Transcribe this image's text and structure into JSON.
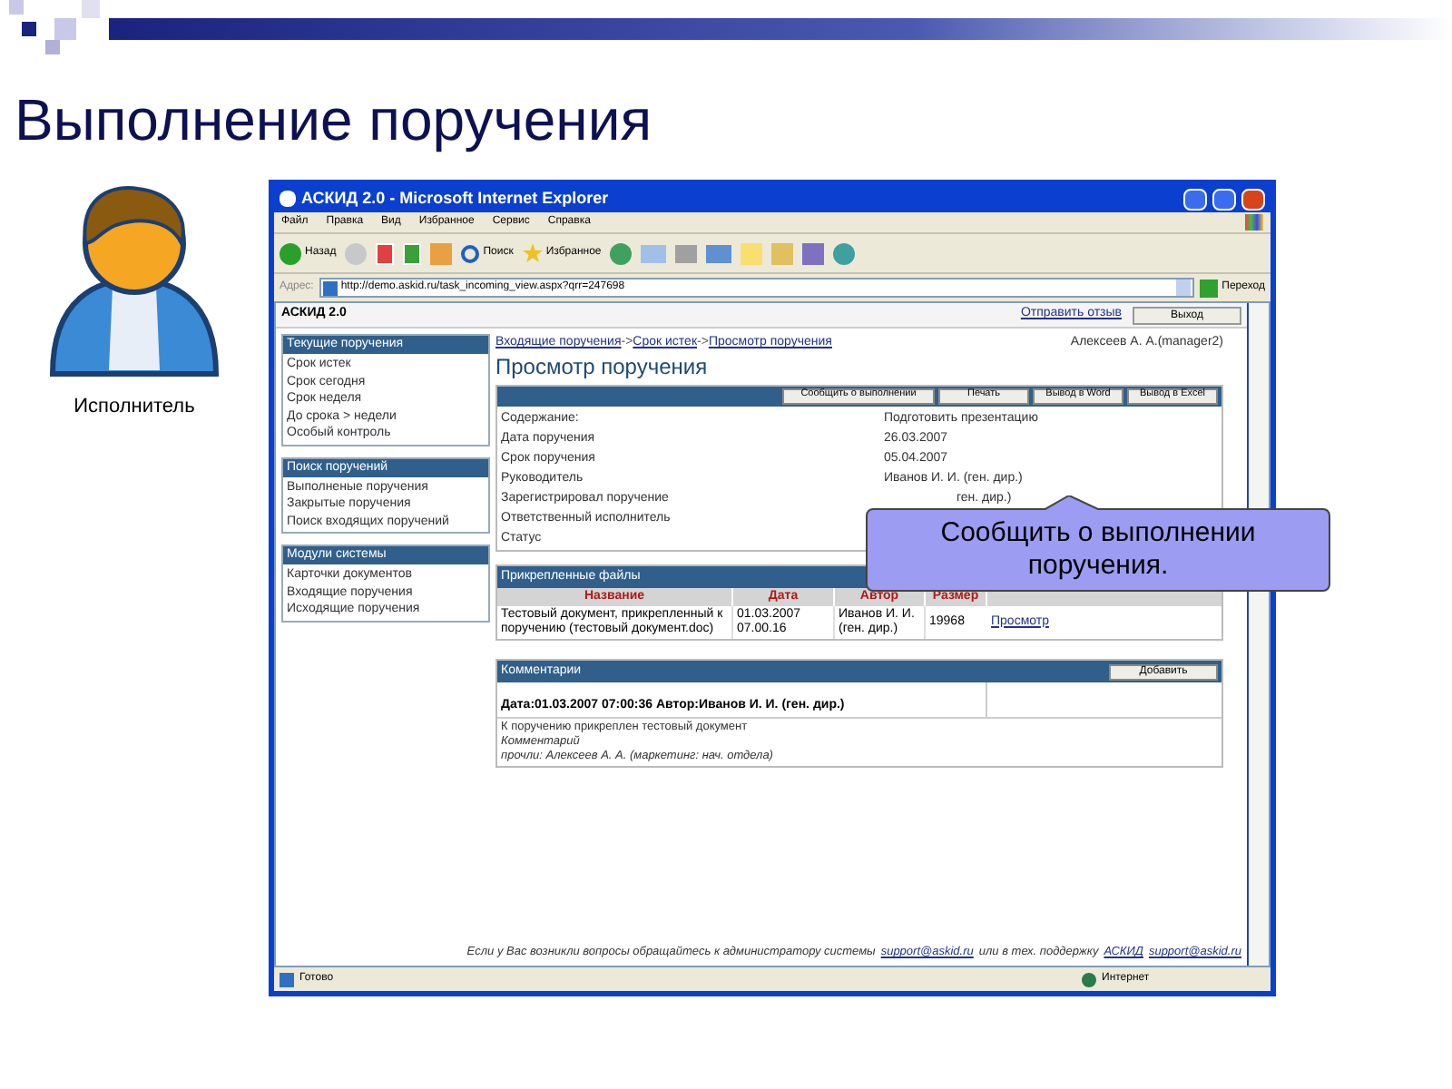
{
  "slide": {
    "title": "Выполнение поручения",
    "actor_label": "Исполнитель"
  },
  "window": {
    "title": "АСКИД 2.0 - Microsoft Internet Explorer",
    "menu": [
      "Файл",
      "Правка",
      "Вид",
      "Избранное",
      "Сервис",
      "Справка"
    ],
    "toolbar": {
      "back": "Назад",
      "search": "Поиск",
      "favorites": "Избранное"
    },
    "address_label": "Адрес:",
    "address": "http://demo.askid.ru/task_incoming_view.aspx?qrr=247698",
    "go": "Переход"
  },
  "page": {
    "app_name": "АСКИД 2.0",
    "feedback_link": "Отправить отзыв",
    "logout": "Выход",
    "sidebar": [
      {
        "title": "Текущие поручения",
        "items": [
          "Срок истек",
          "Срок сегодня",
          "Срок неделя",
          "До срока > недели",
          "Особый контроль"
        ]
      },
      {
        "title": "Поиск поручений",
        "items": [
          "Выполненые поручения",
          "Закрытые поручения",
          "Поиск входящих поручений"
        ]
      },
      {
        "title": "Модули системы",
        "items": [
          "Карточки документов",
          "Входящие поручения",
          "Исходящие поручения"
        ]
      }
    ],
    "breadcrumbs": [
      {
        "kind": "link",
        "text": "Входящие поручения"
      },
      {
        "kind": "sep",
        "text": "->"
      },
      {
        "kind": "link",
        "text": "Срок истек"
      },
      {
        "kind": "sep",
        "text": "->"
      },
      {
        "kind": "link",
        "text": "Просмотр поручения"
      }
    ],
    "user": "Алексеев А. А.(manager2)",
    "heading": "Просмотр поручения",
    "actions": [
      "Сообщить о выполнении",
      "Печать",
      "Вывод в Word",
      "Вывод в Excel"
    ],
    "fields": [
      {
        "label": "Содержание:",
        "value": "Подготовить презентацию"
      },
      {
        "label": "Дата поручения",
        "value": "26.03.2007"
      },
      {
        "label": "Срок поручения",
        "value": "05.04.2007"
      },
      {
        "label": "Руководитель",
        "value": "Иванов И. И. (ген. дир.)"
      },
      {
        "label": "Зарегистрировал поручение",
        "value": "ген. дир.)"
      },
      {
        "label": "Ответственный исполнитель"
      },
      {
        "label": "Статус"
      }
    ],
    "files": {
      "title": "Прикрепленные файлы",
      "columns": [
        "Название",
        "Дата",
        "Автор",
        "Размер"
      ],
      "rows": [
        {
          "name": "Тестовый документ, прикрепленный к поручению (тестовый документ.doc)",
          "date": "01.03.2007 07.00.16",
          "author": "Иванов И. И. (ген. дир.)",
          "size": "19968",
          "link": "Просмотр"
        }
      ]
    },
    "comments": {
      "title": "Комментарии",
      "add": "Добавить",
      "entries": [
        {
          "header": "Дата:01.03.2007 07:00:36 Автор:Иванов И. И. (ген. дир.)",
          "lines": [
            {
              "text": "К поручению прикреплен тестовый документ",
              "italic": false
            },
            {
              "text": "Комментарий",
              "italic": true
            },
            {
              "text": "прочли: Алексеев А. А. (маркетинг: нач. отдела)",
              "italic": true
            }
          ]
        }
      ]
    },
    "footer": [
      {
        "kind": "text",
        "text": "Если у Вас возникли вопросы обращайтесь к администратору системы"
      },
      {
        "kind": "link",
        "text": "support@askid.ru"
      },
      {
        "kind": "text",
        "text": "или в тех. поддержку"
      },
      {
        "kind": "link",
        "text": "АСКИД"
      },
      {
        "kind": "link",
        "text": "support@askid.ru"
      }
    ]
  },
  "status_bar": {
    "status": "Готово",
    "zone": "Интернет"
  },
  "callout": {
    "text": "Сообщить о выполнении поручения."
  }
}
